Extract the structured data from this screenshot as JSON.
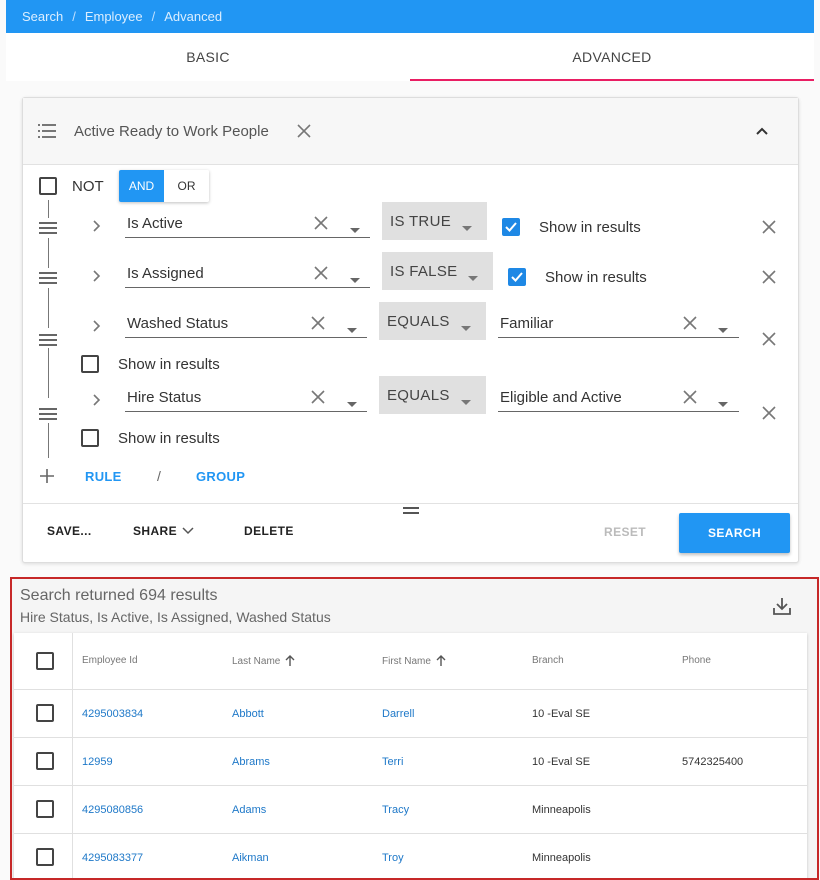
{
  "breadcrumb": [
    "Search",
    "Employee",
    "Advanced"
  ],
  "tabs": [
    {
      "label": "BASIC"
    },
    {
      "label": "ADVANCED"
    }
  ],
  "query": {
    "name": "Active Ready to Work People",
    "not_label": "NOT",
    "and_label": "AND",
    "or_label": "OR",
    "rules": [
      {
        "field": "Is Active",
        "operator": "IS TRUE",
        "value": "",
        "show_label": "Show in results",
        "show_checked": true
      },
      {
        "field": "Is Assigned",
        "operator": "IS FALSE",
        "value": "",
        "show_label": "Show in results",
        "show_checked": true
      },
      {
        "field": "Washed Status",
        "operator": "EQUALS",
        "value": "Familiar",
        "show_label": "Show in results",
        "show_checked": false
      },
      {
        "field": "Hire Status",
        "operator": "EQUALS",
        "value": "Eligible and Active",
        "show_label": "Show in results",
        "show_checked": false
      }
    ],
    "add_rule_label": "RULE",
    "add_separator": "/",
    "add_group_label": "GROUP"
  },
  "actions": {
    "save": "SAVE...",
    "share": "SHARE",
    "delete": "DELETE",
    "reset": "RESET",
    "search": "SEARCH"
  },
  "results": {
    "count_text": "Search returned 694 results",
    "fields_text": "Hire Status, Is Active, Is Assigned, Washed Status",
    "columns": [
      "Employee Id",
      "Last Name",
      "First Name",
      "Branch",
      "Phone"
    ],
    "rows": [
      {
        "id": "4295003834",
        "last": "Abbott",
        "first": "Darrell",
        "branch": "10 -Eval SE",
        "phone": ""
      },
      {
        "id": "12959",
        "last": "Abrams",
        "first": "Terri",
        "branch": "10 -Eval SE",
        "phone": "5742325400"
      },
      {
        "id": "4295080856",
        "last": "Adams",
        "first": "Tracy",
        "branch": "Minneapolis",
        "phone": ""
      },
      {
        "id": "4295083377",
        "last": "Aikman",
        "first": "Troy",
        "branch": "Minneapolis",
        "phone": ""
      }
    ]
  }
}
